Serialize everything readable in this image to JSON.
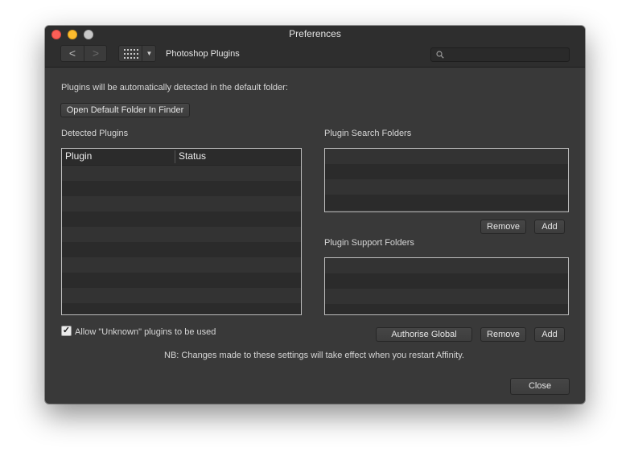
{
  "window": {
    "title": "Preferences"
  },
  "toolbar": {
    "back_glyph": "<",
    "forward_glyph": ">",
    "dropdown_glyph": "▼",
    "section_title": "Photoshop Plugins",
    "search": {
      "value": "",
      "placeholder": ""
    }
  },
  "main": {
    "intro": "Plugins will be automatically detected in the default folder:",
    "open_folder_button": "Open Default Folder In Finder",
    "detected": {
      "title": "Detected Plugins",
      "columns": [
        "Plugin",
        "Status"
      ],
      "rows": []
    },
    "search_folders": {
      "title": "Plugin Search Folders",
      "items": [],
      "remove_button": "Remove",
      "add_button": "Add"
    },
    "support_folders": {
      "title": "Plugin Support Folders",
      "items": [],
      "authorise_button": "Authorise Global",
      "remove_button": "Remove",
      "add_button": "Add"
    },
    "allow_unknown": {
      "label": "Allow \"Unknown\" plugins to be used",
      "checked": true,
      "check_glyph": "✓"
    },
    "note": "NB: Changes made to these settings will take effect when you restart Affinity.",
    "close_button": "Close"
  }
}
